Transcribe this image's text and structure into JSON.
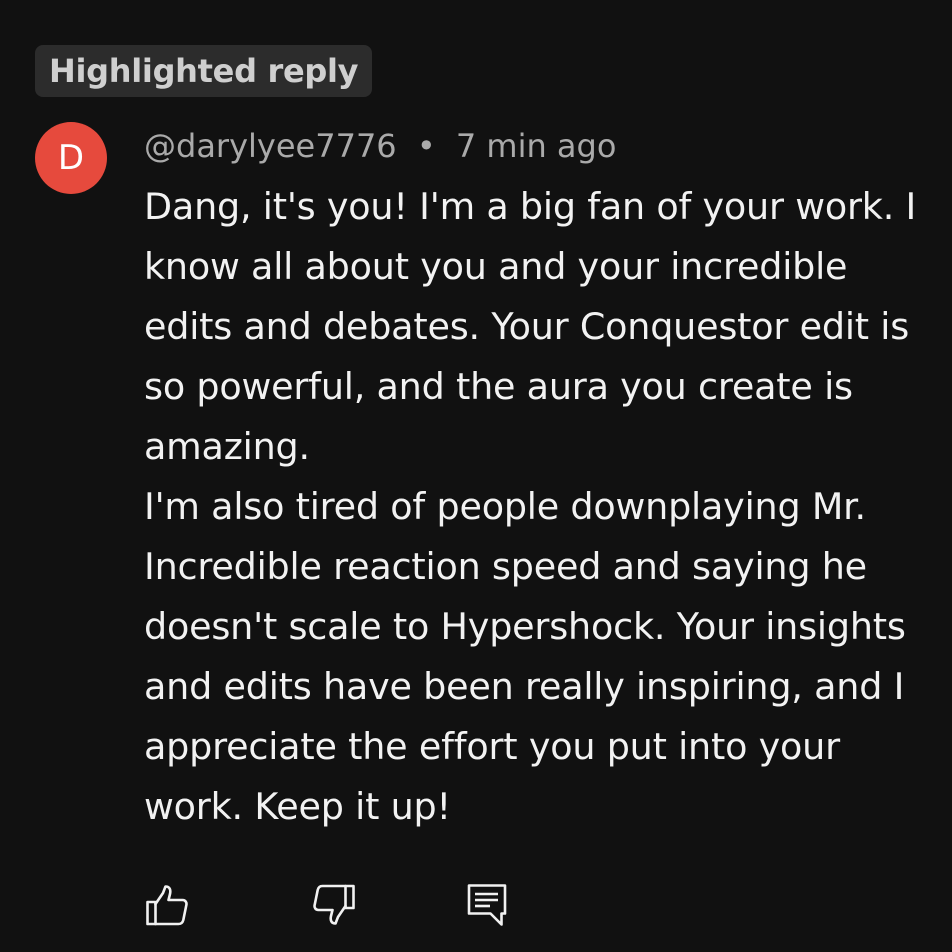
{
  "badge": {
    "label": "Highlighted reply"
  },
  "comment": {
    "avatar_letter": "D",
    "avatar_color": "#e64a3d",
    "username": "@darylyee7776",
    "separator": "•",
    "timestamp": "7 min ago",
    "lines": [
      "Dang, it's you! I'm a big fan of your work. I",
      "know all about you and your incredible",
      "edits and debates. Your Conquestor edit is",
      "so powerful, and the aura you create is",
      "amazing.",
      "I'm also tired of people downplaying Mr.",
      "Incredible reaction speed and saying he",
      "doesn't scale to Hypershock. Your insights",
      "and edits have been really inspiring, and I",
      "appreciate the effort you put into your",
      "work. Keep it up!"
    ]
  },
  "actions": {
    "like_icon": "thumbs-up-icon",
    "dislike_icon": "thumbs-down-icon",
    "reply_icon": "comment-icon"
  }
}
